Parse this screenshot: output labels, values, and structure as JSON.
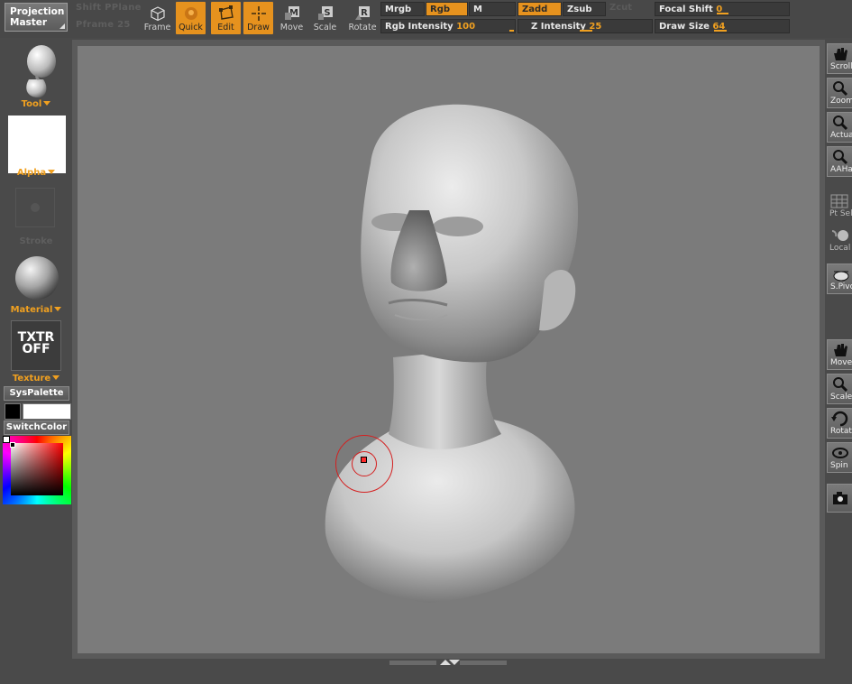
{
  "toolbar": {
    "projection_master": {
      "line1": "Projection",
      "line2": "Master"
    },
    "ghost_top": "Shift PPlane",
    "ghost_bottom": "Pframe 25",
    "tools": [
      {
        "label": "Frame",
        "icon": "cube-frame-icon",
        "active": false
      },
      {
        "label": "Quick",
        "icon": "quick-sketch-icon",
        "active": true
      },
      {
        "label": "Edit",
        "icon": "edit-frame-icon",
        "active": true
      },
      {
        "label": "Draw",
        "icon": "draw-crosshair-icon",
        "active": true
      },
      {
        "label": "Move",
        "icon": "move-m-icon",
        "active": false
      },
      {
        "label": "Scale",
        "icon": "scale-s-icon",
        "active": false
      },
      {
        "label": "Rotate",
        "icon": "rotate-r-icon",
        "active": false
      }
    ],
    "mrgb": "Mrgb",
    "rgb": "Rgb",
    "m": "M",
    "zadd": "Zadd",
    "zsub": "Zsub",
    "zcut": "Zcut",
    "rgb_intensity_label": "Rgb Intensity",
    "rgb_intensity_value": "100",
    "z_intensity_label": "Z Intensity",
    "z_intensity_value": "25",
    "focal_shift_label": "Focal Shift",
    "focal_shift_value": "0",
    "draw_size_label": "Draw Size",
    "draw_size_value": "64"
  },
  "left_shelf": {
    "tool_label": "Tool",
    "alpha_label": "Alpha",
    "stroke_label": "Stroke",
    "material_label": "Material",
    "texture_line1": "TXTR",
    "texture_line2": "OFF",
    "texture_label": "Texture",
    "syspalette": "SysPalette",
    "switchcolor": "SwitchColor"
  },
  "right_shelf": [
    {
      "label": "Scroll",
      "icon": "hand-scroll-icon"
    },
    {
      "label": "Zoom",
      "icon": "zoom-icon"
    },
    {
      "label": "Actual",
      "icon": "actual-size-icon"
    },
    {
      "label": "AAHalf",
      "icon": "aahalf-icon"
    },
    {
      "label": "Pt Sel",
      "icon": "point-select-icon"
    },
    {
      "label": "Local",
      "icon": "local-icon"
    },
    {
      "label": "S.Pivot",
      "icon": "spivot-icon"
    },
    {
      "label": "Move",
      "icon": "move-hand-icon"
    },
    {
      "label": "Scale",
      "icon": "scale-icon"
    },
    {
      "label": "Rotate",
      "icon": "rotate-icon"
    },
    {
      "label": "Spin",
      "icon": "spin-icon"
    },
    {
      "label": "",
      "icon": "camera-icon"
    }
  ],
  "colors": {
    "accent": "#e6921e",
    "panel": "#4a4a4a",
    "canvas": "#7b7b7b",
    "brush_cursor": "#d42020"
  }
}
